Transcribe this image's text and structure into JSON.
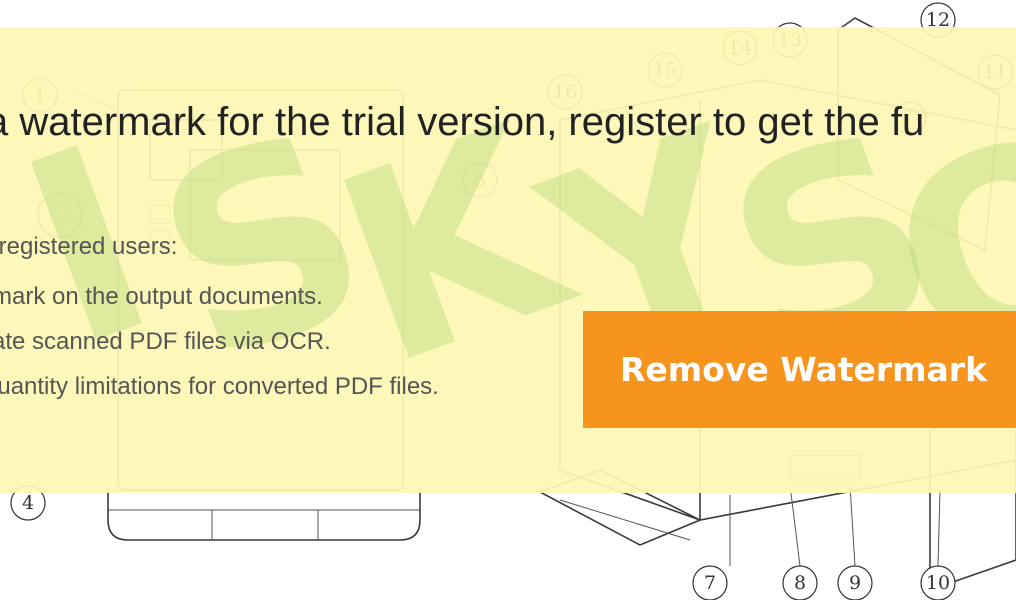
{
  "promo": {
    "headline": "a watermark for the trial version, register to get the fu",
    "subheading": "r registered users:",
    "benefits": [
      "rmark on the output documents.",
      "rate scanned PDF files via OCR.",
      "quantity limitations for converted PDF files."
    ],
    "button_label": "Remove Watermark",
    "colors": {
      "overlay": "#fdf8b4",
      "button": "#f7941d",
      "watermark_letters": "#b2d778"
    }
  },
  "watermark": {
    "letters": [
      "I",
      "S",
      "K",
      "Y",
      "S",
      "O"
    ]
  },
  "diagram": {
    "callouts": [
      "1",
      "4",
      "5",
      "7",
      "8",
      "9",
      "10",
      "11",
      "12",
      "13",
      "14",
      "15",
      "16"
    ]
  }
}
